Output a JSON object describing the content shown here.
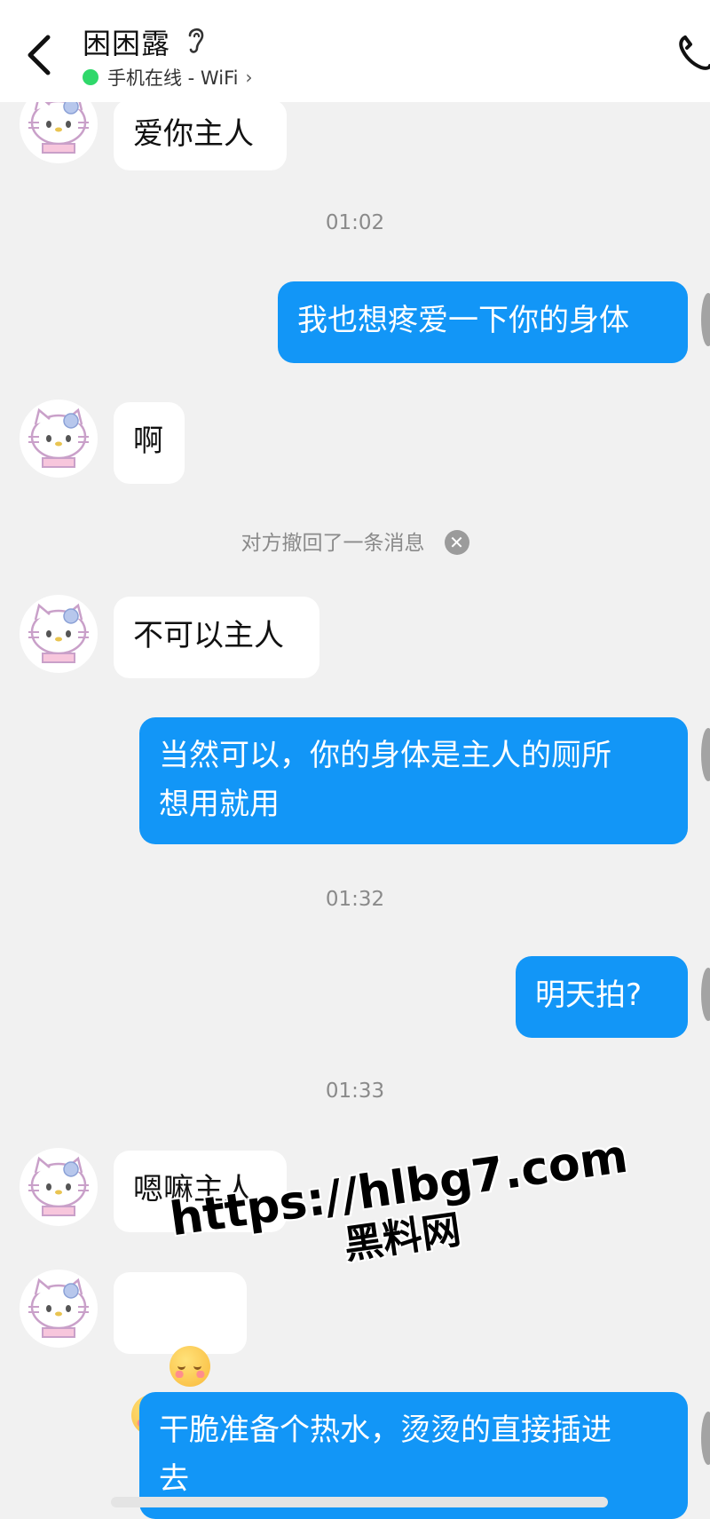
{
  "header": {
    "contact_name": "困困露",
    "status": "手机在线 - WiFi",
    "status_chevron": "›",
    "status_color": "#2fd86a"
  },
  "messages": [
    {
      "side": "in",
      "text": "爱你主人"
    },
    {
      "type": "time",
      "text": "01:02"
    },
    {
      "side": "out",
      "text": "我也想疼爱一下你的身体"
    },
    {
      "side": "in",
      "text": "啊"
    },
    {
      "type": "recall",
      "text": "对方撤回了一条消息"
    },
    {
      "side": "in",
      "text": "不可以主人"
    },
    {
      "side": "out",
      "text": "当然可以，你的身体是主人的厕所\n想用就用"
    },
    {
      "type": "time",
      "text": "01:32"
    },
    {
      "side": "out",
      "text": "明天拍?"
    },
    {
      "type": "time",
      "text": "01:33"
    },
    {
      "side": "in",
      "text": "嗯嘛主人"
    },
    {
      "side": "in",
      "emoji": [
        "relieved-face-emoji",
        "relieved-face-emoji"
      ]
    },
    {
      "side": "out",
      "text": "干脆准备个热水，烫烫的直接插进\n去"
    }
  ],
  "watermark": {
    "line1": "https://hlbg7.com",
    "line2": "黑料网"
  },
  "colors": {
    "outgoing_bubble": "#1296f7",
    "incoming_bubble": "#ffffff",
    "background": "#f1f1f1"
  }
}
